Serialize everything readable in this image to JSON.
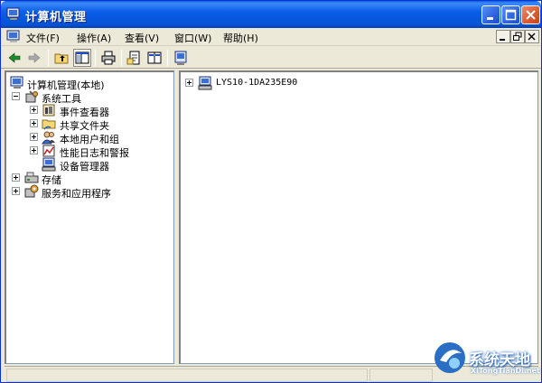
{
  "window": {
    "title": "计算机管理",
    "colors": {
      "titlebar": "#0553d6",
      "close_button": "#d95a32",
      "face": "#ece9d8",
      "pane_border": "#7f9db9"
    }
  },
  "menu": {
    "items": [
      {
        "label": "文件(F)"
      },
      {
        "label": "操作(A)"
      },
      {
        "label": "查看(V)"
      },
      {
        "label": "窗口(W)"
      },
      {
        "label": "帮助(H)"
      }
    ]
  },
  "toolbar": {
    "icons": [
      "back-arrow-icon",
      "forward-arrow-icon",
      "up-folder-icon",
      "show-hide-tree-icon",
      "print-icon",
      "properties-icon",
      "help-icon",
      "console-icon"
    ]
  },
  "tree": {
    "root": "计算机管理(本地)",
    "system_tools": "系统工具",
    "event_viewer": "事件查看器",
    "shared_folders": "共享文件夹",
    "local_users_groups": "本地用户和组",
    "perf_logs": "性能日志和警报",
    "device_manager": "设备管理器",
    "storage": "存储",
    "services_apps": "服务和应用程序"
  },
  "content": {
    "computer_node": "LYS10-1DA235E90"
  },
  "watermark": {
    "title": "系统天地",
    "subtitle": "XiTongTianDi.net"
  }
}
